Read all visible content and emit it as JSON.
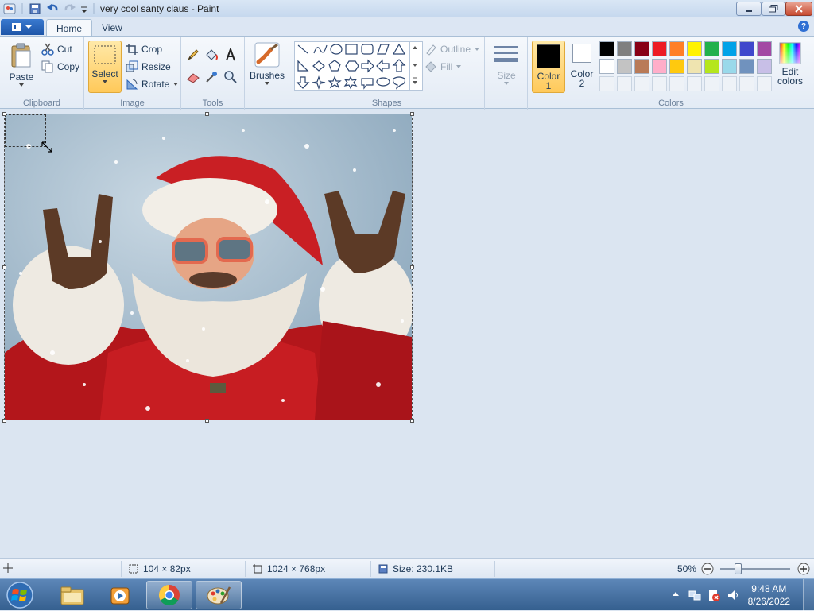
{
  "window": {
    "title": "very cool santy claus - Paint"
  },
  "tabs": [
    {
      "label": "Home"
    },
    {
      "label": "View"
    }
  ],
  "clipboard": {
    "paste_label": "Paste",
    "cut_label": "Cut",
    "copy_label": "Copy",
    "group_label": "Clipboard"
  },
  "image": {
    "select_label": "Select",
    "crop_label": "Crop",
    "resize_label": "Resize",
    "rotate_label": "Rotate",
    "group_label": "Image"
  },
  "tools": {
    "group_label": "Tools"
  },
  "brushes": {
    "label": "Brushes"
  },
  "shapes": {
    "outline_label": "Outline",
    "fill_label": "Fill",
    "group_label": "Shapes"
  },
  "size": {
    "label": "Size"
  },
  "colors": {
    "color1_label": "Color",
    "color1_num": "1",
    "color2_label": "Color",
    "color2_num": "2",
    "edit_label": "Edit",
    "edit_label2": "colors",
    "group_label": "Colors",
    "color1": "#000000",
    "color2": "#ffffff",
    "palette_row1": [
      "#000000",
      "#7f7f7f",
      "#880015",
      "#ed1c24",
      "#ff7f27",
      "#fff200",
      "#22b14c",
      "#00a2e8",
      "#3f48cc",
      "#a349a4"
    ],
    "palette_row2": [
      "#ffffff",
      "#c3c3c3",
      "#b97a57",
      "#ffaec9",
      "#ffc90e",
      "#efe4b0",
      "#b5e61d",
      "#99d9ea",
      "#7092be",
      "#c8bfe7"
    ]
  },
  "status": {
    "selection_size": "104 × 82px",
    "image_size": "1024 × 768px",
    "file_size": "Size: 230.1KB",
    "zoom": "50%"
  },
  "taskbar": {
    "time": "9:48 AM",
    "date": "8/26/2022"
  }
}
